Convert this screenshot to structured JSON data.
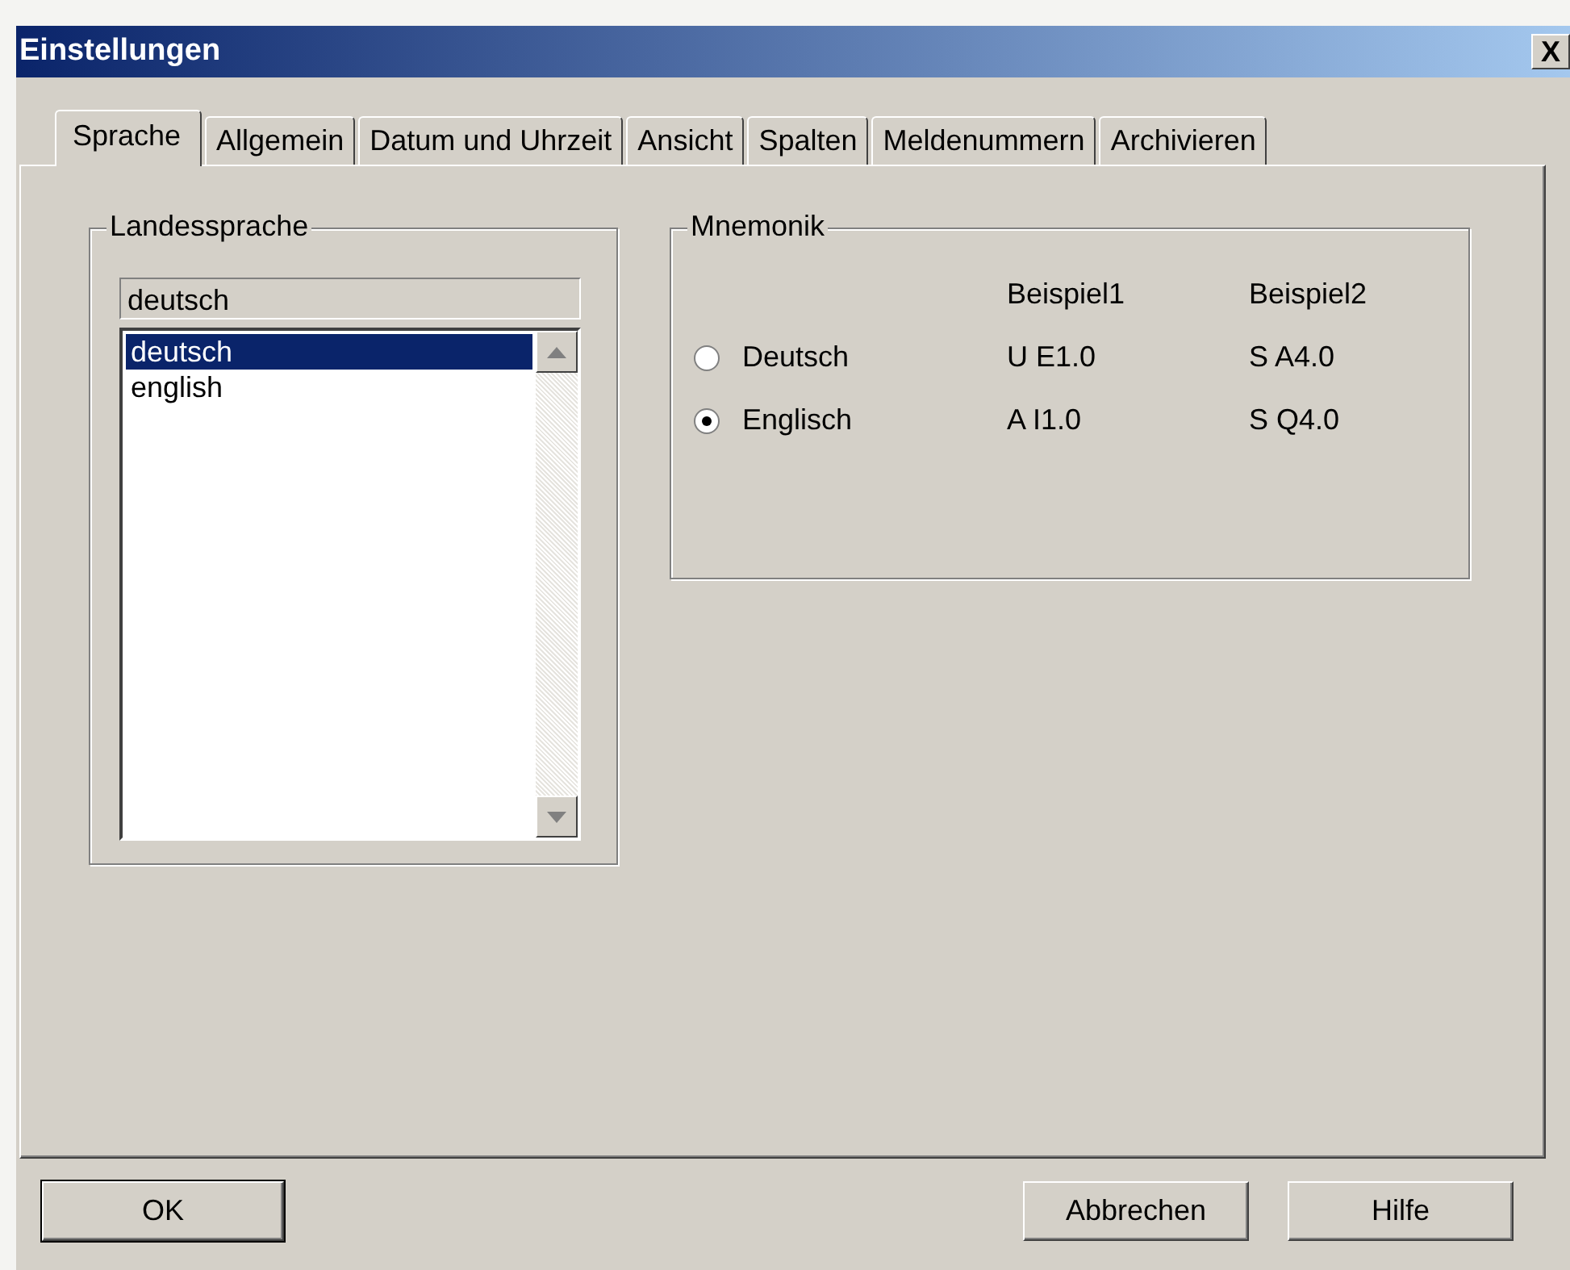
{
  "window": {
    "title": "Einstellungen",
    "close": "X"
  },
  "tabs": [
    {
      "label": "Sprache",
      "selected": true
    },
    {
      "label": "Allgemein",
      "selected": false
    },
    {
      "label": "Datum und Uhrzeit",
      "selected": false
    },
    {
      "label": "Ansicht",
      "selected": false
    },
    {
      "label": "Spalten",
      "selected": false
    },
    {
      "label": "Meldenummern",
      "selected": false
    },
    {
      "label": "Archivieren",
      "selected": false
    }
  ],
  "language_group": {
    "label": "Landessprache",
    "current": "deutsch",
    "items": [
      {
        "label": "deutsch",
        "selected": true
      },
      {
        "label": "english",
        "selected": false
      }
    ]
  },
  "mnemonic_group": {
    "label": "Mnemonik",
    "columns": [
      "Beispiel1",
      "Beispiel2"
    ],
    "options": [
      {
        "label": "Deutsch",
        "selected": false,
        "examples": [
          "U E1.0",
          "S A4.0"
        ]
      },
      {
        "label": "Englisch",
        "selected": true,
        "examples": [
          "A I1.0",
          "S Q4.0"
        ]
      }
    ]
  },
  "buttons": [
    {
      "label": "OK",
      "default": true
    },
    {
      "label": "Abbrechen",
      "default": false
    },
    {
      "label": "Hilfe",
      "default": false
    }
  ]
}
